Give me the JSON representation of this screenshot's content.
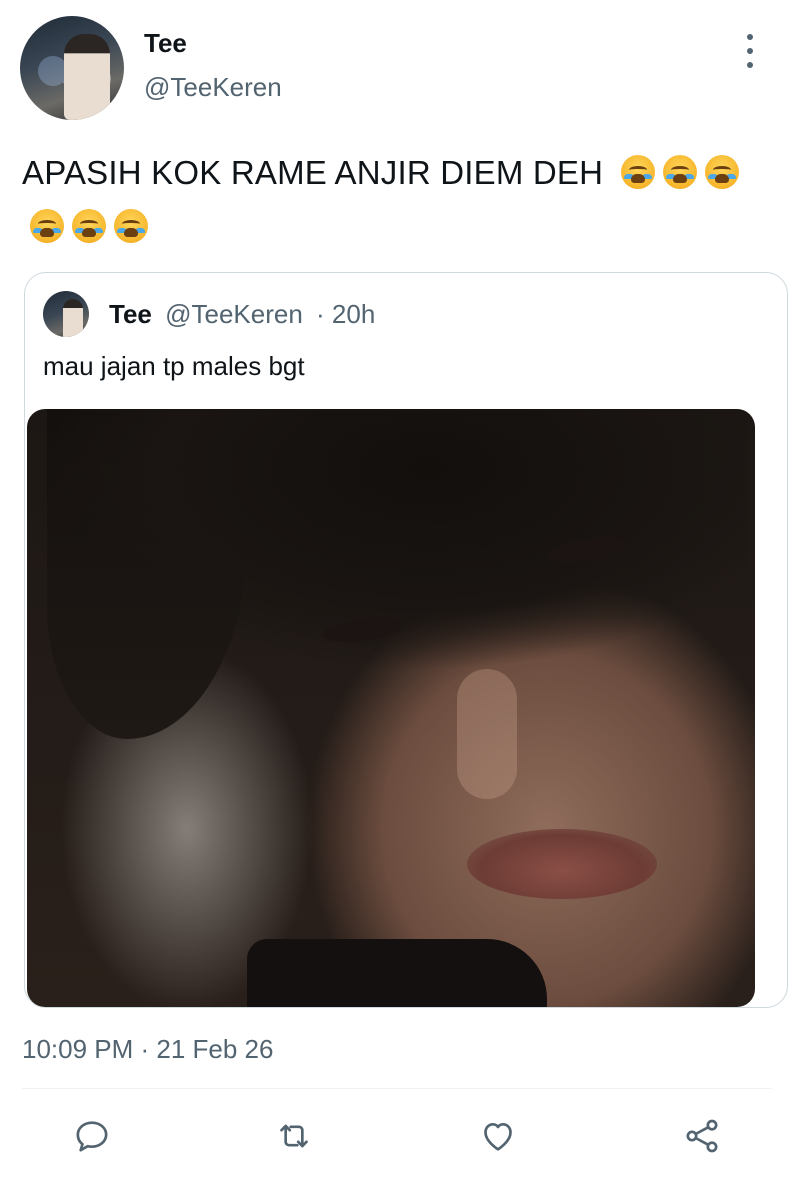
{
  "tweet": {
    "author": {
      "display_name": "Tee",
      "handle": "@TeeKeren"
    },
    "text": "APASIH KOK RAME ANJIR DIEM DEH",
    "emoji": [
      "loudly-crying-face",
      "loudly-crying-face",
      "loudly-crying-face",
      "loudly-crying-face",
      "loudly-crying-face",
      "loudly-crying-face"
    ],
    "timestamp": "10:09 PM · 21 Feb 26"
  },
  "quoted_tweet": {
    "author": {
      "display_name": "Tee",
      "handle": "@TeeKeren"
    },
    "age": "· 20h",
    "text": "mau jajan tp males bgt",
    "media": {
      "type": "photo"
    }
  },
  "actions": [
    {
      "name": "reply",
      "icon": "reply-icon"
    },
    {
      "name": "retweet",
      "icon": "retweet-icon"
    },
    {
      "name": "like",
      "icon": "heart-icon"
    },
    {
      "name": "share",
      "icon": "share-icon"
    }
  ],
  "colors": {
    "text_primary": "#0f1419",
    "text_secondary": "#536471",
    "border": "#cfd9de",
    "icon": "#536471"
  }
}
